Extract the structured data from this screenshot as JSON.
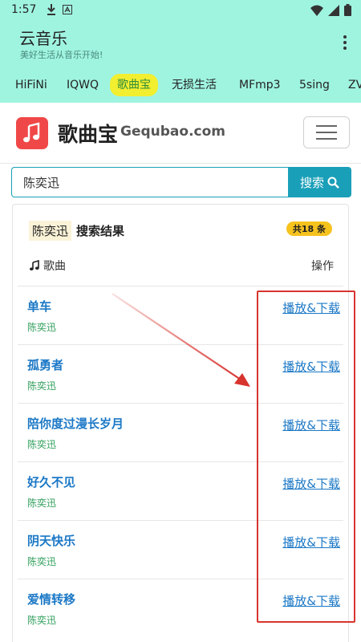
{
  "status": {
    "time": "1:57"
  },
  "app": {
    "title": "云音乐",
    "subtitle": "美好生活从音乐开始!"
  },
  "tabs": [
    {
      "label": "HiFiNi"
    },
    {
      "label": "IQWQ"
    },
    {
      "label": "歌曲宝"
    },
    {
      "label": "无损生活"
    },
    {
      "label": "MFmp3"
    },
    {
      "label": "5sing"
    },
    {
      "label": "ZV"
    }
  ],
  "site": {
    "name": "歌曲宝",
    "domain": "Gequbao.com"
  },
  "search": {
    "value": "陈奕迅",
    "button_label": "搜索"
  },
  "results": {
    "keyword": "陈奕迅",
    "label": "搜索结果",
    "count": "共18 条",
    "col_song": "歌曲",
    "col_action": "操作",
    "items": [
      {
        "title": "单车",
        "artist": "陈奕迅",
        "action": "播放&下载"
      },
      {
        "title": "孤勇者",
        "artist": "陈奕迅",
        "action": "播放&下载"
      },
      {
        "title": "陪你度过漫长岁月",
        "artist": "陈奕迅",
        "action": "播放&下载"
      },
      {
        "title": "好久不见",
        "artist": "陈奕迅",
        "action": "播放&下载"
      },
      {
        "title": "阴天快乐",
        "artist": "陈奕迅",
        "action": "播放&下载"
      },
      {
        "title": "爱情转移",
        "artist": "陈奕迅",
        "action": "播放&下载"
      }
    ]
  },
  "colors": {
    "header_bg": "#9ff4e0",
    "accent": "#1a9fb8",
    "link": "#1b78c6",
    "artist": "#2e9e5a",
    "annotation": "#d8342e"
  }
}
